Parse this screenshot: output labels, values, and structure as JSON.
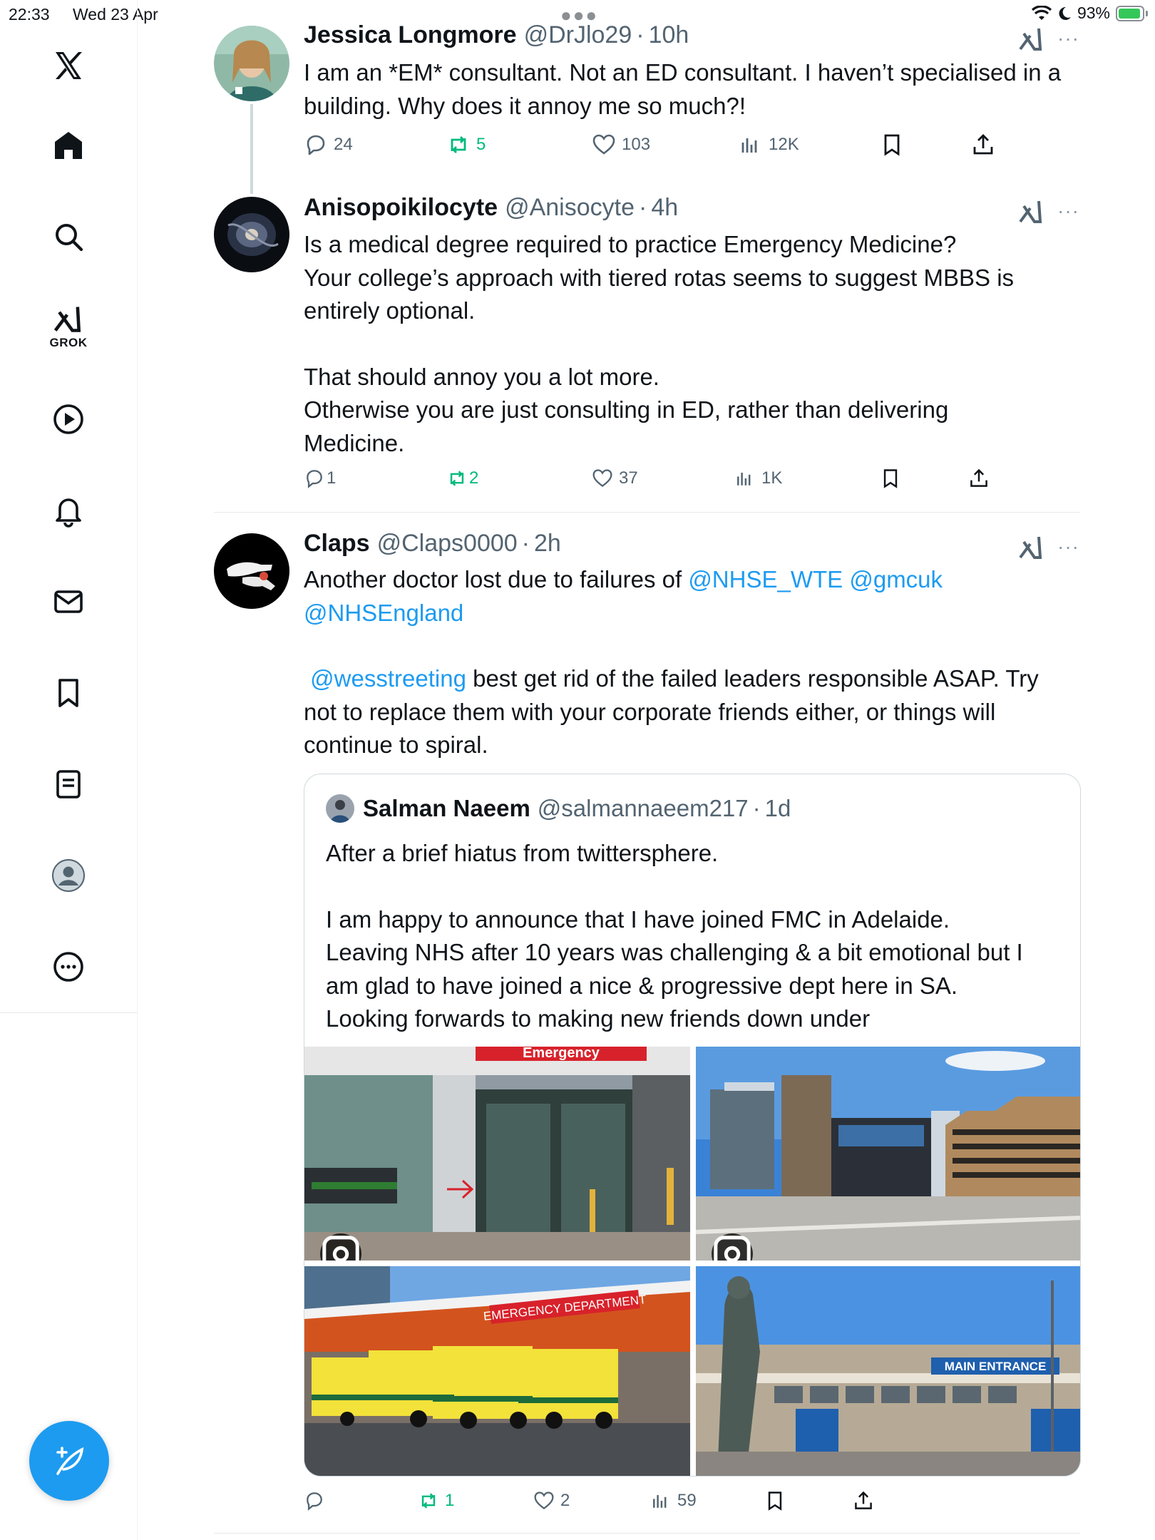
{
  "status_bar": {
    "time": "22:33",
    "date": "Wed 23 Apr",
    "battery": "93%"
  },
  "sidebar": {
    "grok_label": "GROK",
    "items": [
      "X",
      "Home",
      "Search",
      "Grok",
      "Videos",
      "Notifications",
      "Messages",
      "Bookmarks",
      "Lists",
      "Profile",
      "More"
    ]
  },
  "tweets": [
    {
      "name": "Jessica Longmore",
      "handle": "@DrJlo29",
      "time": "10h",
      "body": [
        "I am an *EM* consultant. Not an ED consultant. I haven’t specialised in a",
        "building. Why does it annoy me so much?!"
      ],
      "replies": "24",
      "reposts": "5",
      "likes": "103",
      "views": "12K"
    },
    {
      "name": "Anisopoikilocyte",
      "handle": "@Anisocyte",
      "time": "4h",
      "body": [
        "Is a medical degree required to practice Emergency Medicine?",
        "Your college’s approach with tiered rotas seems to suggest MBBS is",
        "entirely optional.",
        "",
        "That should annoy you a lot more.",
        "Otherwise you are just consulting in ED, rather than delivering",
        "Medicine."
      ],
      "replies": "1",
      "reposts": "2",
      "likes": "37",
      "views": "1K"
    },
    {
      "name": "Claps",
      "handle": "@Claps0000",
      "time": "2h",
      "body_line1_text": "Another doctor lost due to failures of ",
      "mention_1": "@NHSE_WTE",
      "mention_2": "@gmcuk",
      "mention_3": "@NHSEngland",
      "mention_4": "@wesstreeting",
      "body_line4_text": " best get rid of the failed leaders responsible ASAP. Try",
      "body_line5": "not to replace them with your corporate friends either, or things will",
      "body_line6": "continue to spiral.",
      "replies": "",
      "reposts": "1",
      "likes": "2",
      "views": "59",
      "quote": {
        "name": "Salman Naeem",
        "handle": "@salmannaeem217",
        "time": "1d",
        "body": [
          "After a brief hiatus from twittersphere.",
          "",
          "I am happy to announce that I have  joined FMC in Adelaide.",
          "Leaving NHS after 10 years was challenging & a bit emotional but I",
          "am glad to have joined a nice & progressive dept here in SA.",
          "Looking forwards to making new friends down under"
        ],
        "photo_signs": {
          "emergency": "Emergency",
          "ed": "EMERGENCY DEPARTMENT",
          "main": "MAIN ENTRANCE"
        }
      }
    }
  ],
  "separator_dot": "·",
  "colors": {
    "accent": "#1d9bf0",
    "repost": "#00ba7c",
    "secondary": "#536471"
  }
}
